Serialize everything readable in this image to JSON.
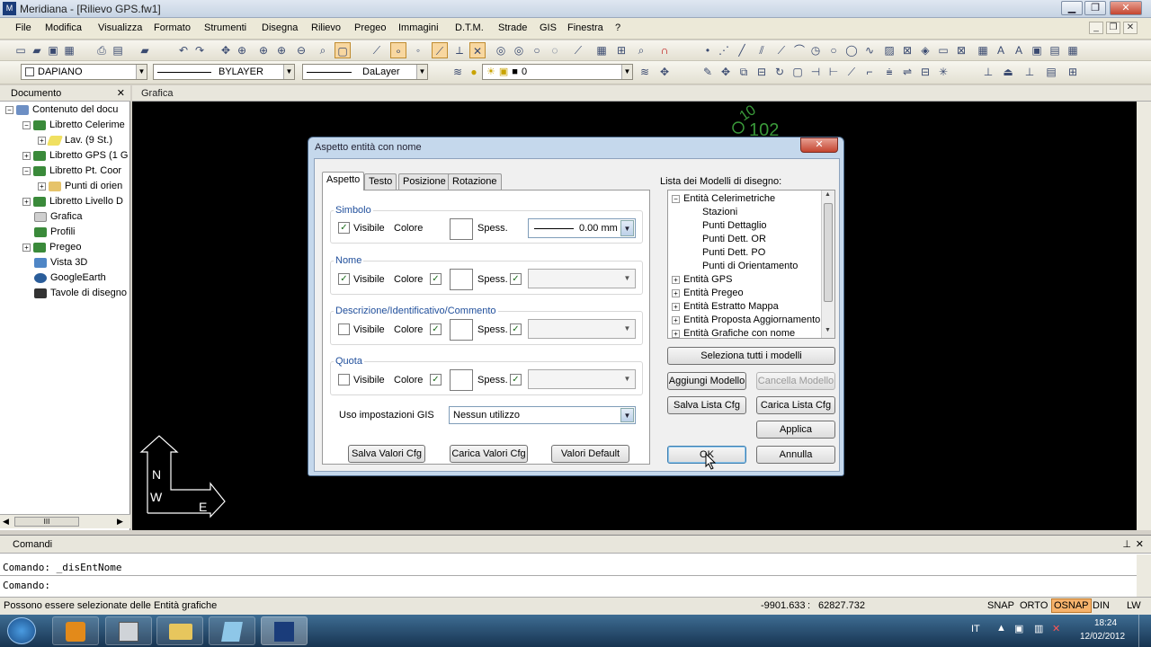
{
  "app": {
    "title": "Meridiana - [Rilievo GPS.fw1]",
    "icon_name": "meridiana-app-icon",
    "window_buttons": {
      "minimize": "▁",
      "restore": "❐",
      "close": "✕"
    },
    "mdi_buttons": {
      "minimize": "_",
      "restore": "❐",
      "close": "✕"
    }
  },
  "menu": {
    "items": [
      "File",
      "Modifica",
      "Visualizza",
      "Formato",
      "Strumenti",
      "Disegna",
      "Rilievo",
      "Pregeo",
      "Immagini",
      "D.T.M.",
      "Strade",
      "GIS",
      "Finestra",
      "?"
    ]
  },
  "toolbar2": {
    "layer": "DAPIANO",
    "linetype": "BYLAYER",
    "layer_line": "DaLayer",
    "layer_state": "0"
  },
  "document_pane": {
    "title": "Documento",
    "close_glyph": "✕",
    "items": [
      {
        "label": "Contenuto del docu",
        "expander": "−",
        "icon": "document-icon"
      },
      {
        "label": "Libretto Celerime",
        "expander": "−",
        "icon": "book-icon"
      },
      {
        "label": "Lav.  (9 St.)",
        "expander": "+",
        "icon": "note-icon"
      },
      {
        "label": "Libretto GPS (1 G",
        "expander": "+",
        "icon": "book-icon"
      },
      {
        "label": "Libretto Pt. Coor",
        "expander": "−",
        "icon": "book-icon"
      },
      {
        "label": "Punti di orien",
        "expander": "+",
        "icon": "folder-icon"
      },
      {
        "label": "Libretto Livello D",
        "expander": "+",
        "icon": "book-icon"
      },
      {
        "label": "Grafica",
        "expander": "",
        "icon": "drawing-icon"
      },
      {
        "label": "Profili",
        "expander": "",
        "icon": "book-icon"
      },
      {
        "label": "Pregeo",
        "expander": "+",
        "icon": "book-icon"
      },
      {
        "label": "Vista 3D",
        "expander": "",
        "icon": "view3d-icon"
      },
      {
        "label": "GoogleEarth",
        "expander": "",
        "icon": "globe-icon"
      },
      {
        "label": "Tavole di disegno",
        "expander": "",
        "icon": "sheet-icon"
      }
    ],
    "hscroll_grip": "III"
  },
  "graphics_pane": {
    "title": "Grafica",
    "point_label": "102",
    "point_prefix": "10",
    "compass": {
      "north": "N",
      "west": "W",
      "east": "E"
    }
  },
  "command_pane": {
    "title": "Comandi",
    "pin_glyph": "⊥",
    "close_glyph": "✕",
    "lines": [
      "Comando: _disEntNome",
      "Comando:"
    ]
  },
  "status": {
    "message": "Possono essere selezionate delle Entità grafiche",
    "coords_x": "-9901.633",
    "coords_sep": ":",
    "coords_y": "62827.732",
    "modes": [
      {
        "label": "SNAP",
        "active": false
      },
      {
        "label": "ORTO",
        "active": false
      },
      {
        "label": "OSNAP",
        "active": true
      },
      {
        "label": "DIN",
        "active": false
      },
      {
        "label": "LW",
        "active": false
      }
    ]
  },
  "taskbar": {
    "lang": "IT",
    "time": "18:24",
    "date": "12/02/2012"
  },
  "dialog": {
    "title": "Aspetto entità con nome",
    "close_glyph": "✕",
    "tabs": [
      "Aspetto",
      "Testo",
      "Posizione",
      "Rotazione"
    ],
    "active_tab": "Aspetto",
    "groups": {
      "simbolo": {
        "title": "Simbolo",
        "visible_label": "Visibile",
        "visible_checked": true,
        "color_label": "Colore",
        "thick_label": "Spess.",
        "thick_value": "0.00 mm"
      },
      "nome": {
        "title": "Nome",
        "visible_label": "Visibile",
        "visible_checked": true,
        "color_label": "Colore",
        "thick_label": "Spess."
      },
      "descrizione": {
        "title": "Descrizione/Identificativo/Commento",
        "visible_label": "Visibile",
        "visible_checked": false,
        "color_label": "Colore",
        "thick_label": "Spess."
      },
      "quota": {
        "title": "Quota",
        "visible_label": "Visibile",
        "visible_checked": false,
        "color_label": "Colore",
        "thick_label": "Spess."
      }
    },
    "gis_label": "Uso impostazioni GIS",
    "gis_value": "Nessun utilizzo",
    "bottom_buttons": {
      "save": "Salva Valori Cfg",
      "load": "Carica Valori Cfg",
      "defaults": "Valori Default"
    },
    "models_label": "Lista dei Modelli di disegno:",
    "models": [
      {
        "label": "Entità Celerimetriche",
        "expander": "−",
        "indent": 0
      },
      {
        "label": "Stazioni",
        "expander": "",
        "indent": 1
      },
      {
        "label": "Punti Dettaglio",
        "expander": "",
        "indent": 1
      },
      {
        "label": "Punti Dett. OR",
        "expander": "",
        "indent": 1
      },
      {
        "label": "Punti Dett. PO",
        "expander": "",
        "indent": 1
      },
      {
        "label": "Punti di Orientamento",
        "expander": "",
        "indent": 1
      },
      {
        "label": "Entità GPS",
        "expander": "+",
        "indent": 0
      },
      {
        "label": "Entità Pregeo",
        "expander": "+",
        "indent": 0
      },
      {
        "label": "Entità Estratto Mappa",
        "expander": "+",
        "indent": 0
      },
      {
        "label": "Entità Proposta Aggiornamento",
        "expander": "+",
        "indent": 0
      },
      {
        "label": "Entità Grafiche con nome",
        "expander": "+",
        "indent": 0
      }
    ],
    "right_buttons": {
      "select_all": "Seleziona  tutti i modelli",
      "add_model": "Aggiungi Modello",
      "delete_model": "Cancella Modello",
      "save_list": "Salva Lista Cfg",
      "load_list": "Carica Lista Cfg",
      "apply": "Applica",
      "ok": "OK",
      "cancel": "Annulla"
    }
  }
}
